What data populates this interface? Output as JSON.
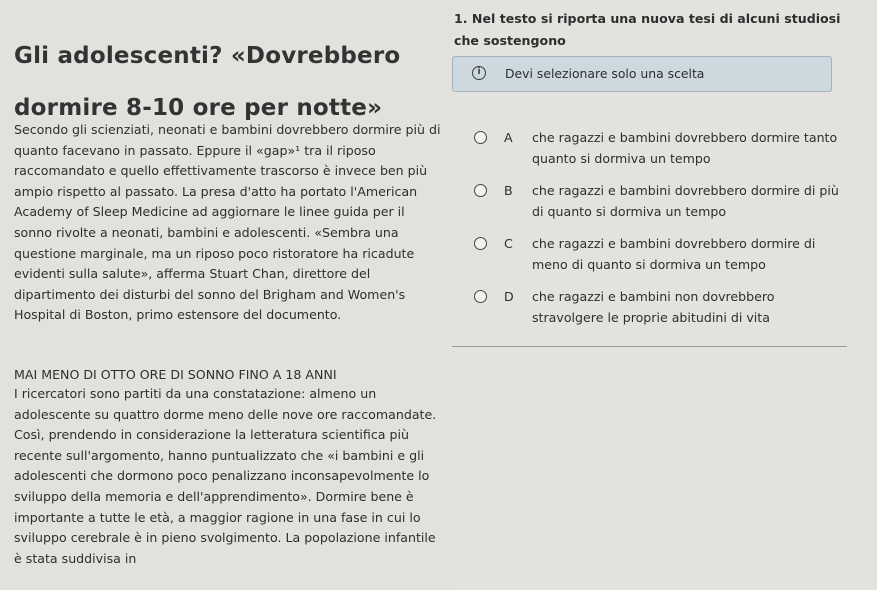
{
  "article": {
    "title": "Gli adolescenti? «Dovrebbero dormire 8-10 ore per notte»",
    "paragraph1": "Secondo gli scienziati, neonati e bambini dovrebbero dormire più di quanto facevano in passato. Eppure il «gap»¹ tra il riposo raccomandato e quello effettivamente trascorso è invece ben più ampio rispetto al passato. La presa d'atto ha portato l'American Academy of Sleep Medicine ad aggiornare le linee guida per il sonno rivolte a neonati, bambini e adolescenti. «Sembra una questione marginale, ma un riposo poco ristoratore ha ricadute evidenti sulla salute», afferma Stuart Chan, direttore del dipartimento dei disturbi del sonno del Brigham and Women's Hospital di Boston, primo estensore del documento.",
    "section_heading": "MAI MENO DI OTTO ORE DI SONNO FINO A 18 ANNI",
    "paragraph2": "I ricercatori sono partiti da una constatazione: almeno un adolescente su quattro dorme meno delle nove ore raccomandate. Così, prendendo in considerazione la letteratura scientifica più recente sull'argomento, hanno puntualizzato che «i bambini e gli adolescenti che dormono poco penalizzano inconsapevolmente lo sviluppo della memoria e dell'apprendimento». Dormire bene è importante a tutte le età, a maggior ragione in una fase in cui lo sviluppo cerebrale è in pieno svolgimento. La popolazione infantile è stata suddivisa in"
  },
  "question": {
    "title": "1. Nel testo si riporta una nuova tesi di alcuni studiosi che sostengono",
    "notice": {
      "icon": "info-icon",
      "text": "Devi selezionare solo una scelta"
    },
    "options": [
      {
        "letter": "A",
        "text": "che ragazzi e bambini dovrebbero dormire tanto quanto si dormiva un tempo"
      },
      {
        "letter": "B",
        "text": "che ragazzi e bambini dovrebbero dormire di più di quanto si dormiva un tempo"
      },
      {
        "letter": "C",
        "text": "che ragazzi e bambini dovrebbero dormire di meno di quanto si dormiva un tempo"
      },
      {
        "letter": "D",
        "text": "che ragazzi e bambini non dovrebbero stravolgere le proprie abitudini di vita"
      }
    ]
  }
}
